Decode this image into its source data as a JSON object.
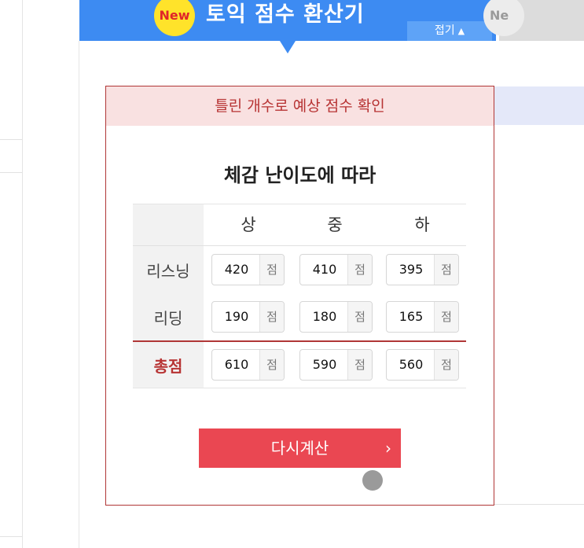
{
  "header": {
    "badge": "New",
    "title": "토익 점수 환산기",
    "fold_label": "접기",
    "fold_icon": "▲",
    "next_tab_badge": "Ne"
  },
  "card": {
    "header": "틀린 개수로 예상 점수 확인",
    "subtitle": "체감 난이도에 따라",
    "columns": [
      "상",
      "중",
      "하"
    ],
    "unit": "점",
    "rows": [
      {
        "label": "리스닝",
        "values": [
          "420",
          "410",
          "395"
        ]
      },
      {
        "label": "리딩",
        "values": [
          "190",
          "180",
          "165"
        ]
      },
      {
        "label": "총점",
        "values": [
          "610",
          "590",
          "560"
        ]
      }
    ],
    "recalc_label": "다시계산",
    "recalc_icon": "›"
  },
  "colors": {
    "header_blue": "#3d8bf2",
    "badge_yellow": "#ffe32a",
    "accent_red": "#b03636",
    "button_red": "#ea4752"
  }
}
